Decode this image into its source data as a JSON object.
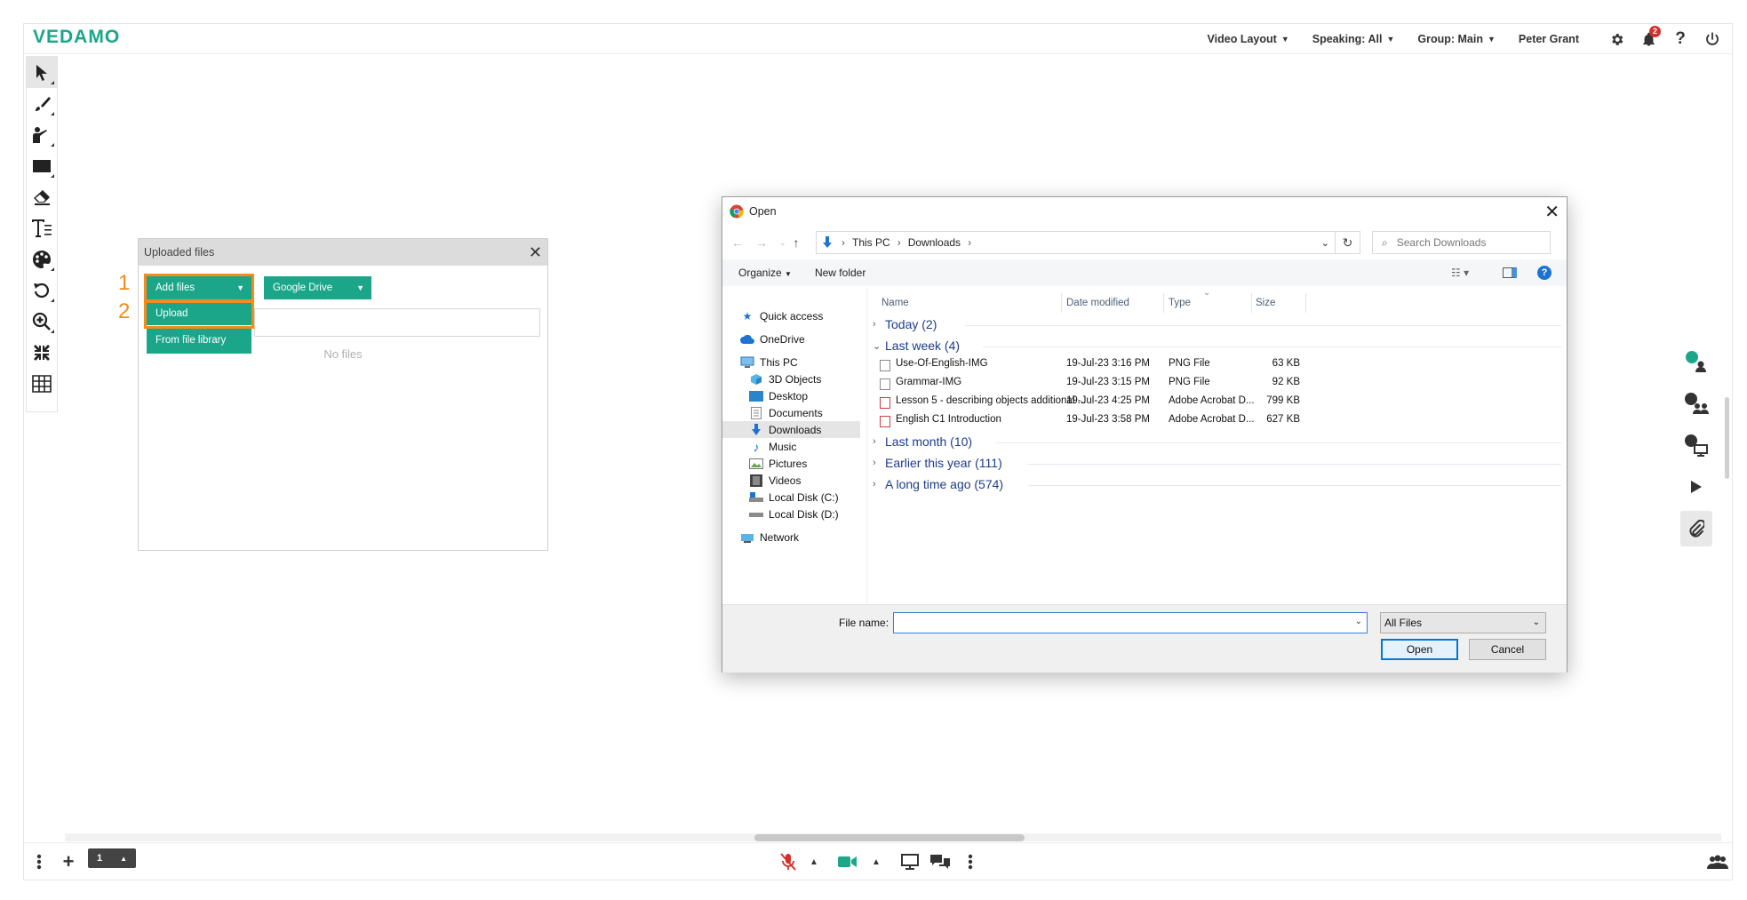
{
  "app": {
    "logo": "VEDAMO"
  },
  "topbar": {
    "video_layout": "Video Layout",
    "speaking": "Speaking: All",
    "group": "Group: Main",
    "user": "Peter Grant",
    "notifications_count": "2"
  },
  "uploaded_panel": {
    "title": "Uploaded files",
    "add_files": "Add files",
    "google_drive": "Google Drive",
    "upload": "Upload",
    "from_library": "From file library",
    "empty": "No files",
    "marker_1": "1",
    "marker_2": "2"
  },
  "bottombar": {
    "page": "1"
  },
  "dialog": {
    "title": "Open",
    "path": [
      "This PC",
      "Downloads"
    ],
    "search_placeholder": "Search Downloads",
    "organize": "Organize",
    "new_folder": "New folder",
    "nav": {
      "quick_access": "Quick access",
      "onedrive": "OneDrive",
      "this_pc": "This PC",
      "objects3d": "3D Objects",
      "desktop": "Desktop",
      "documents": "Documents",
      "downloads": "Downloads",
      "music": "Music",
      "pictures": "Pictures",
      "videos": "Videos",
      "disk_c": "Local Disk (C:)",
      "disk_d": "Local Disk (D:)",
      "network": "Network"
    },
    "columns": {
      "name": "Name",
      "date": "Date modified",
      "type": "Type",
      "size": "Size"
    },
    "groups": {
      "today": "Today (2)",
      "last_week": "Last week (4)",
      "last_month": "Last month (10)",
      "earlier_year": "Earlier this year (111)",
      "long_ago": "A long time ago (574)"
    },
    "files": [
      {
        "name": "Use-Of-English-IMG",
        "date": "19-Jul-23 3:16 PM",
        "type": "PNG File",
        "size": "63 KB"
      },
      {
        "name": "Grammar-IMG",
        "date": "19-Jul-23 3:15 PM",
        "type": "PNG File",
        "size": "92 KB"
      },
      {
        "name": "Lesson 5 - describing objects additional ...",
        "date": "19-Jul-23 4:25 PM",
        "type": "Adobe Acrobat D...",
        "size": "799 KB"
      },
      {
        "name": "English C1 Introduction",
        "date": "19-Jul-23 3:58 PM",
        "type": "Adobe Acrobat D...",
        "size": "627 KB"
      }
    ],
    "file_name_label": "File name:",
    "file_name_value": "",
    "file_type": "All Files",
    "open_button": "Open",
    "cancel_button": "Cancel"
  },
  "colors": {
    "brand": "#1ba68a",
    "highlight": "#f28c1e",
    "accent_blue": "#0078d7"
  }
}
